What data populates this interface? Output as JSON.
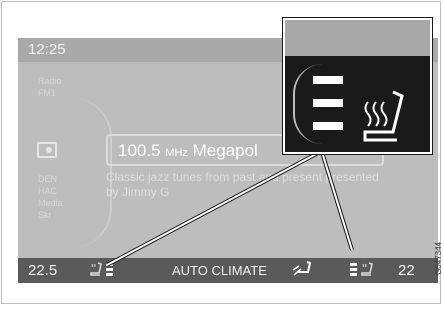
{
  "screen": {
    "time": "12:25",
    "side_labels": [
      "Radio",
      "FM1",
      "DEN",
      "HAC",
      "Media",
      "Skr"
    ],
    "station": {
      "frequency": "100.5",
      "unit": "MHz",
      "name": "Megapol"
    },
    "radio_text": "Classic jazz tunes from past and present presented by Jimmy G"
  },
  "climate_bar": {
    "left_temp": "22.5",
    "right_temp": "22",
    "label": "AUTO CLIMATE",
    "left_seat_heat_level": 3,
    "right_seat_heat_level": 3
  },
  "zoom": {
    "seat_heat_level": 3
  },
  "figure_code": "G047344",
  "colors": {
    "screen_bg": "#bdbdbd",
    "climate_bar": "#5a5a5a",
    "zoom_bg": "#1a1a1a"
  }
}
